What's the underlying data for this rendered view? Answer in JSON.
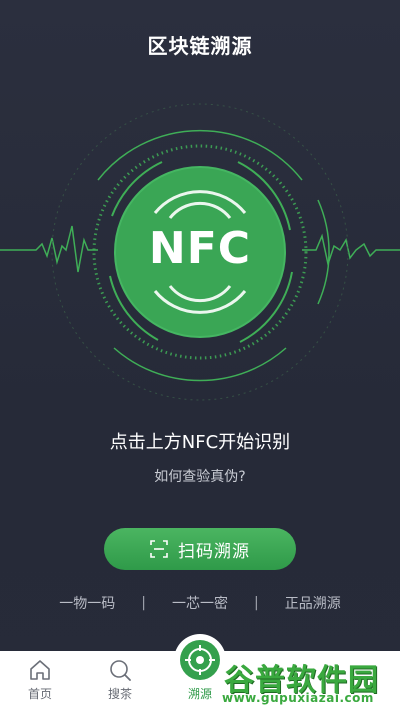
{
  "header": {
    "title": "区块链溯源"
  },
  "nfc": {
    "label": "NFC",
    "instruction": "点击上方NFC开始识别",
    "help_link": "如何查验真伪?"
  },
  "scan_button": {
    "label": "扫码溯源",
    "icon": "scan-icon"
  },
  "features": [
    "一物一码",
    "一芯一密",
    "正品溯源"
  ],
  "separator": "|",
  "tabbar": {
    "tabs": [
      {
        "label": "首页",
        "icon": "home-icon"
      },
      {
        "label": "搜茶",
        "icon": "search-icon"
      },
      {
        "label": "溯源",
        "icon": "target-icon",
        "active": true
      }
    ]
  },
  "watermark": {
    "text": "谷普软件园",
    "url": "www.gupuxiazai.com"
  },
  "colors": {
    "background": "#272b39",
    "accent_green": "#34a04d",
    "nfc_green": "#3aa655",
    "tab_active": "#2f9a49"
  }
}
